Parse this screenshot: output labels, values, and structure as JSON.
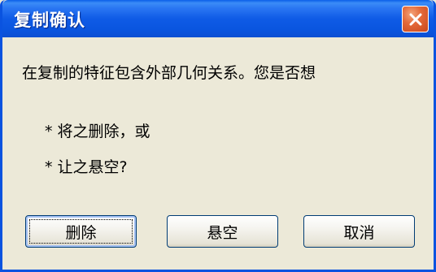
{
  "window": {
    "title": "复制确认"
  },
  "message": {
    "main": "在复制的特征包含外部几何关系。您是否想",
    "option_1": "* 将之删除，或",
    "option_2": "* 让之悬空?"
  },
  "buttons": {
    "delete": "删除",
    "suspend": "悬空",
    "cancel": "取消"
  },
  "icons": {
    "close": "close-icon"
  },
  "colors": {
    "titlebar": "#0a55df",
    "close_button": "#e46a3a",
    "dialog_background": "#ece9d8"
  }
}
